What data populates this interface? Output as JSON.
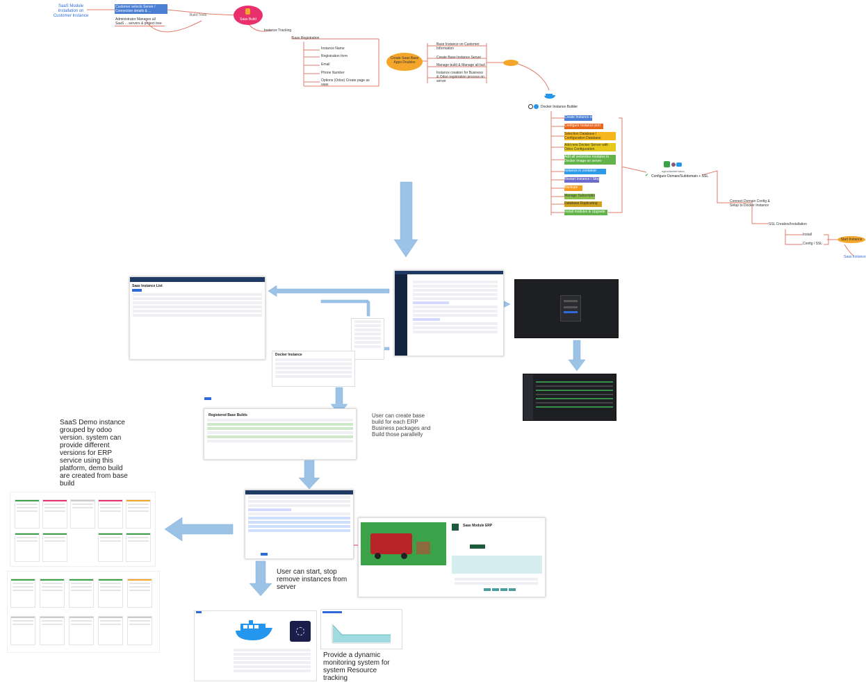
{
  "colors": {
    "arrow": "#9cc3e6",
    "mindmap_line": "#e07b6b",
    "accent_red": "#e8316c",
    "orange": "#f4a62a",
    "docker_blue": "#2496ed",
    "odoo_purple": "#875a7b",
    "dark_panel": "#1e1f22"
  },
  "mindmap": {
    "root_title": "SaaS Module Installation on Customer Instance",
    "top_box_1": "Customer selects Server / Connection details & ...",
    "top_box_2": "Administrator Manages all SaaS ... servers & project tree",
    "link_label": "Build Tools",
    "saas_node": "Saas Build",
    "saas_tracking": "Instance Tracking",
    "saas_registration": "Saas Registration",
    "registration_items": [
      "Instance Name",
      "Registration form",
      "Email",
      "Phone Number",
      "Options (Odoo) Create page as saas"
    ],
    "orange_node": "Create Saas Base Apps Doubles",
    "right_items": [
      "Base Instance on Customer Information",
      "Create Base Instance Server",
      "Manage build & Manage all build",
      "Instance creation for Business & Odoo registration process on server"
    ],
    "small_orange": "",
    "docker_node": "Docker Instance Builder",
    "colored_items": [
      {
        "label": "Create Instance on ...",
        "color": "#4a7fd4"
      },
      {
        "label": "Configure Instance port",
        "color": "#e8651c"
      },
      {
        "label": "Selection Database / Configuration Database",
        "color": "#f4b81c"
      },
      {
        "label": "Add new Docker Server with Odoo Configuration",
        "color": "#e7c91c"
      },
      {
        "label": "Add all web/odoo modules to Docker Image on server",
        "color": "#62b34a"
      },
      {
        "label": "Instance in container",
        "color": "#2e9be8"
      },
      {
        "label": "Restart Instance / Stop",
        "color": "#6b6bcc"
      },
      {
        "label": "Backups",
        "color": "#f49a1c"
      },
      {
        "label": "Manage Subscription",
        "color": "#8cc04a"
      },
      {
        "label": "Database Duplicating",
        "color": "#d0a21c"
      },
      {
        "label": "Install modules & Upgrade",
        "color": "#62b34a"
      }
    ],
    "nginx_label": "nginx/docker/odoo",
    "check_text": "Configure Domain/Subdomain + SSL",
    "far_node_1": "Connect Domain Config & Setup to Docker Instance",
    "far_node_2": "SSL Creation/Installation",
    "far_items": [
      "Install",
      "Config / SSL"
    ],
    "final_node": "Start Instance",
    "final_link": "Saas Instance"
  },
  "captions": {
    "build_text": "User can create base build for each ERP Business packages and Build those parallelly",
    "demo_text": "SaaS Demo instance grouped by odoo version. system can provide different versions for ERP service using this platform, demo build are created from base build",
    "control_text": "User can start, stop remove instances from server",
    "monitor_text": "Provide a dynamic monitoring system for system Resource tracking"
  },
  "screens": {
    "saas_list_title": "Saas Instance List",
    "build_title": "Registered Base Builds",
    "instance_title": "Docker Instance",
    "product_title": "Saas Module ERP"
  }
}
